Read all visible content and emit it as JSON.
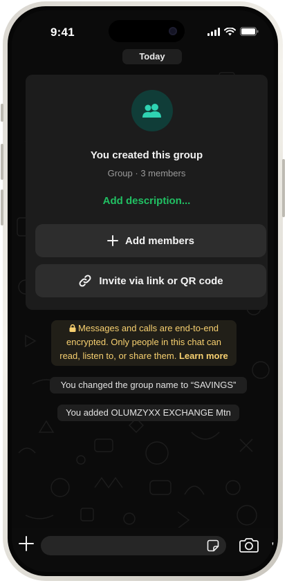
{
  "status_bar": {
    "time": "9:41"
  },
  "chat": {
    "date_label": "Today",
    "group_card": {
      "created_text": "You created this group",
      "meta_text": "Group · 3 members",
      "add_description_label": "Add description...",
      "add_members_label": "Add members",
      "invite_label": "Invite via link or QR code"
    },
    "encryption": {
      "line1": "Messages and calls are end-to-end",
      "line2": "encrypted. Only people in this chat can",
      "line3": "read, listen to, or share them.",
      "learn_more": "Learn more"
    },
    "system_messages": [
      {
        "text": "You changed the group name to “SAVINGS”"
      },
      {
        "text": "You added OLUMZYXX EXCHANGE Mtn"
      }
    ]
  },
  "composer": {
    "message_value": ""
  },
  "icons": {
    "group_avatar": "group-icon",
    "attach": "plus-icon",
    "sticker": "sticker-icon",
    "camera": "camera-icon",
    "mic": "microphone-icon"
  },
  "colors": {
    "accent_green": "#21c063",
    "encryption_text": "#f7d070",
    "avatar_bg": "#103d38"
  }
}
